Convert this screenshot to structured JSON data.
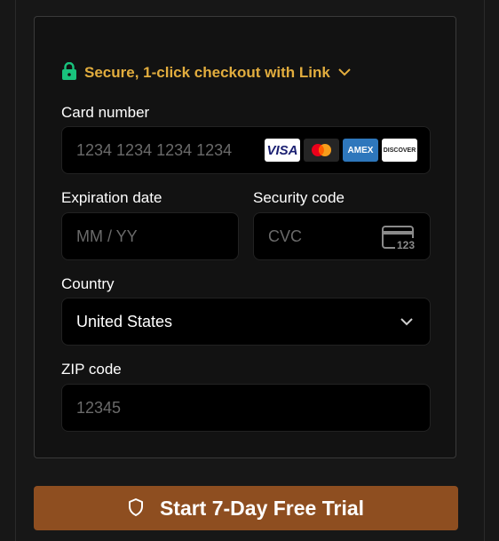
{
  "link": {
    "label": "Secure, 1-click checkout with Link",
    "accent_color": "#e2ad3e",
    "lock_color": "#19c37d"
  },
  "card": {
    "label": "Card number",
    "placeholder": "1234 1234 1234 1234",
    "brands": [
      "VISA",
      "Mastercard",
      "AMEX",
      "DISCOVER"
    ]
  },
  "expiry": {
    "label": "Expiration date",
    "placeholder": "MM / YY"
  },
  "security": {
    "label": "Security code",
    "placeholder": "CVC",
    "icon_text": "123"
  },
  "country": {
    "label": "Country",
    "value": "United States"
  },
  "zip": {
    "label": "ZIP code",
    "placeholder": "12345"
  },
  "cta": {
    "label": "Start 7-Day Free Trial",
    "color": "#8e4e20"
  }
}
